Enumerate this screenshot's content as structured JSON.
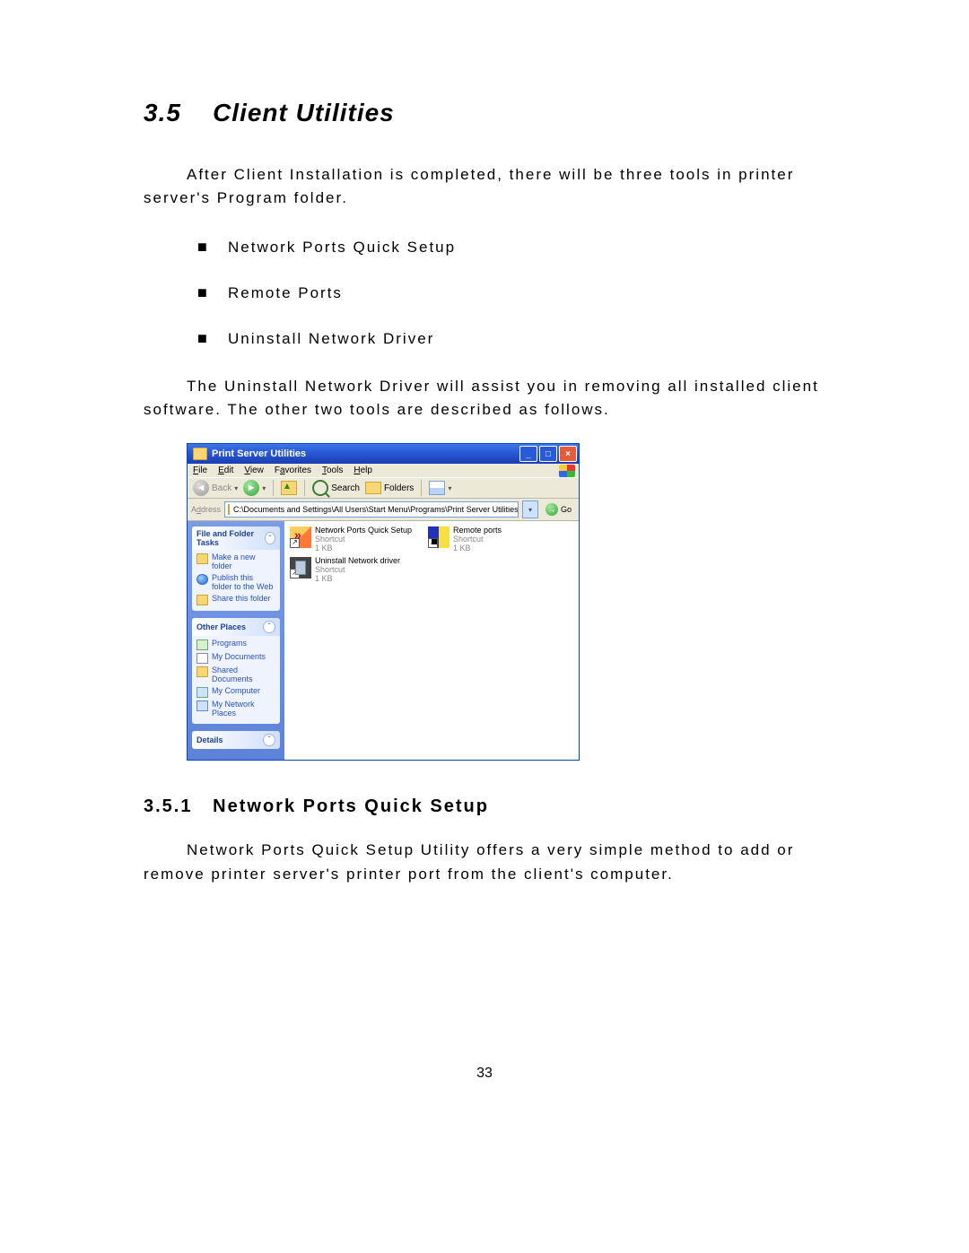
{
  "section": {
    "number": "3.5",
    "title": "Client Utilities"
  },
  "intro": "After Client Installation is completed, there will be three tools in printer server's Program folder.",
  "bullets": [
    "Network Ports Quick Setup",
    "Remote Ports",
    "Uninstall Network Driver"
  ],
  "para2": "The Uninstall Network Driver will assist you in removing all installed client software. The other two tools are described as follows.",
  "subsection": {
    "number": "3.5.1",
    "title": "Network Ports Quick Setup"
  },
  "sub_para": "Network Ports Quick Setup Utility offers a very simple method to add or remove printer server's printer port from the client's computer.",
  "page_number": "33",
  "explorer": {
    "title": "Print Server Utilities",
    "menu": {
      "file": "File",
      "edit": "Edit",
      "view": "View",
      "favorites": "Favorites",
      "tools": "Tools",
      "help": "Help"
    },
    "toolbar": {
      "back": "Back",
      "search": "Search",
      "folders": "Folders"
    },
    "address": {
      "label": "Address",
      "path": "C:\\Documents and Settings\\All Users\\Start Menu\\Programs\\Print Server Utilities",
      "go": "Go"
    },
    "side": {
      "tasks": {
        "title": "File and Folder Tasks",
        "items": [
          "Make a new folder",
          "Publish this folder to the Web",
          "Share this folder"
        ]
      },
      "places": {
        "title": "Other Places",
        "items": [
          "Programs",
          "My Documents",
          "Shared Documents",
          "My Computer",
          "My Network Places"
        ]
      },
      "details": {
        "title": "Details"
      }
    },
    "files": [
      {
        "name": "Network Ports Quick Setup",
        "type": "Shortcut",
        "size": "1 KB",
        "icon": "nq"
      },
      {
        "name": "Remote ports",
        "type": "Shortcut",
        "size": "1 KB",
        "icon": "rp"
      },
      {
        "name": "Uninstall Network driver",
        "type": "Shortcut",
        "size": "1 KB",
        "icon": "un"
      }
    ]
  }
}
